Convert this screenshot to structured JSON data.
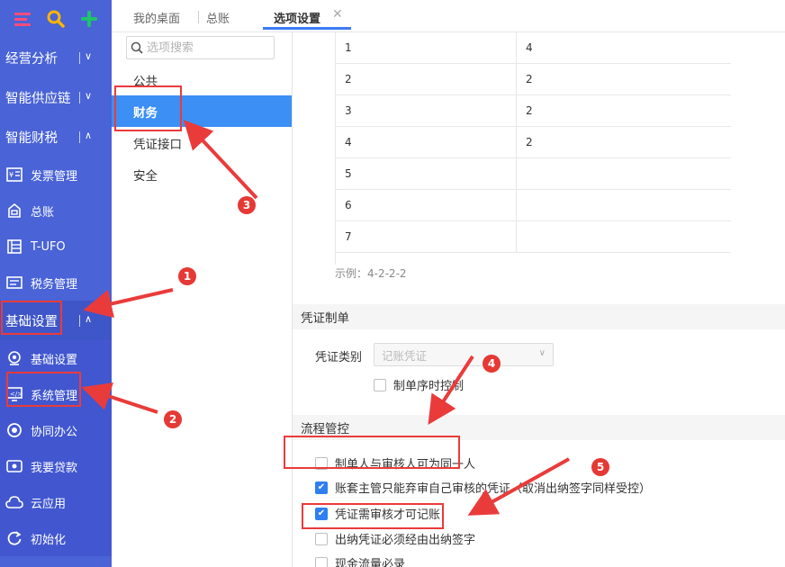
{
  "sidebar": {
    "top_icons": [
      "menu-icon",
      "search-icon",
      "plus-icon"
    ],
    "groups": [
      {
        "label": "经营分析",
        "expanded": false
      },
      {
        "label": "智能供应链",
        "expanded": false
      },
      {
        "label": "智能财税",
        "expanded": true
      }
    ],
    "tax_items": [
      {
        "label": "发票管理",
        "icon": "invoice-icon"
      },
      {
        "label": "总账",
        "icon": "ledger-icon"
      },
      {
        "label": "T-UFO",
        "icon": "report-icon"
      },
      {
        "label": "税务管理",
        "icon": "tax-icon"
      }
    ],
    "basic_group": {
      "label": "基础设置",
      "expanded": true
    },
    "basic_items": [
      {
        "label": "基础设置",
        "icon": "settings-icon"
      },
      {
        "label": "系统管理",
        "icon": "system-icon"
      },
      {
        "label": "协同办公",
        "icon": "collab-icon"
      },
      {
        "label": "我要贷款",
        "icon": "loan-icon"
      },
      {
        "label": "云应用",
        "icon": "cloud-icon"
      },
      {
        "label": "初始化",
        "icon": "init-icon"
      }
    ]
  },
  "tabs": [
    {
      "label": "我的桌面",
      "active": false
    },
    {
      "label": "总账",
      "active": false
    },
    {
      "label": "选项设置",
      "active": true
    }
  ],
  "options_nav": {
    "search_placeholder": "选项搜索",
    "items": [
      {
        "label": "公共",
        "active": false
      },
      {
        "label": "财务",
        "active": true
      },
      {
        "label": "凭证接口",
        "active": false
      },
      {
        "label": "安全",
        "active": false
      }
    ]
  },
  "code_grid": {
    "rows": [
      [
        "1",
        "4"
      ],
      [
        "2",
        "2"
      ],
      [
        "3",
        "2"
      ],
      [
        "4",
        "2"
      ],
      [
        "5",
        ""
      ],
      [
        "6",
        ""
      ],
      [
        "7",
        ""
      ]
    ],
    "example": "示例：4-2-2-2"
  },
  "voucher_section": {
    "title": "凭证制单",
    "type_label": "凭证类别",
    "type_value": "记账凭证",
    "seq_control": {
      "label": "制单序时控制",
      "checked": false
    }
  },
  "flow_section": {
    "title": "流程管控",
    "options": [
      {
        "label": "制单人与审核人可为同一人",
        "checked": false
      },
      {
        "label": "账套主管只能弃审自己审核的凭证（取消出纳签字同样受控）",
        "checked": true
      },
      {
        "label": "凭证需审核才可记账",
        "checked": true
      },
      {
        "label": "出纳凭证必须经由出纳签字",
        "checked": false
      },
      {
        "label": "现金流量必录",
        "checked": false
      }
    ]
  },
  "annotations": [
    "1",
    "2",
    "3",
    "4",
    "5"
  ],
  "colors": {
    "sidebar": "#4a63d6",
    "accent": "#3b8ff5",
    "annotation": "#ea3b3b"
  }
}
